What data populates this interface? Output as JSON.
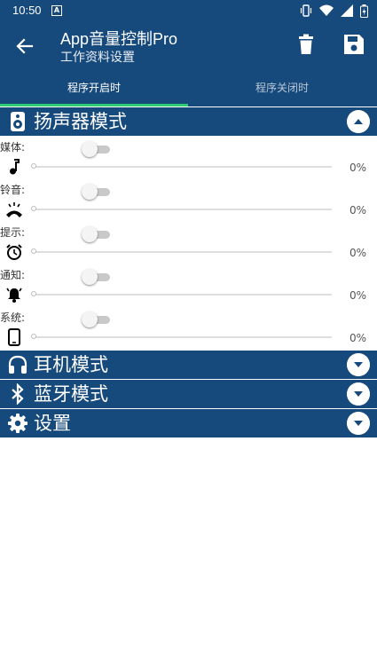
{
  "status_bar": {
    "time": "10:50",
    "notification_badge": "A"
  },
  "app_bar": {
    "title": "App音量控制Pro",
    "subtitle": "工作资料设置"
  },
  "tabs": [
    {
      "label": "程序开启时",
      "active": true
    },
    {
      "label": "程序关闭时",
      "active": false
    }
  ],
  "sections": {
    "speaker": {
      "label": "扬声器模式",
      "icon": "speaker-icon",
      "expanded": true
    },
    "headphones": {
      "label": "耳机模式",
      "icon": "headphones-icon",
      "expanded": false
    },
    "bluetooth": {
      "label": "蓝牙模式",
      "icon": "bluetooth-icon",
      "expanded": false
    },
    "settings": {
      "label": "设置",
      "icon": "gear-icon",
      "expanded": false
    }
  },
  "volume_rows": [
    {
      "label": "媒体:",
      "icon": "music-note-icon",
      "enabled": false,
      "level": 0,
      "percent": "0%"
    },
    {
      "label": "铃音:",
      "icon": "phone-ring-icon",
      "enabled": false,
      "level": 0,
      "percent": "0%"
    },
    {
      "label": "提示:",
      "icon": "alarm-clock-icon",
      "enabled": false,
      "level": 0,
      "percent": "0%"
    },
    {
      "label": "通知:",
      "icon": "bell-icon",
      "enabled": false,
      "level": 0,
      "percent": "0%"
    },
    {
      "label": "系统:",
      "icon": "phone-icon",
      "enabled": false,
      "level": 0,
      "percent": "0%"
    }
  ],
  "colors": {
    "primary": "#174a7c",
    "tab_indicator": "#2ecc71",
    "switch_off_track": "#c8c8c8"
  }
}
